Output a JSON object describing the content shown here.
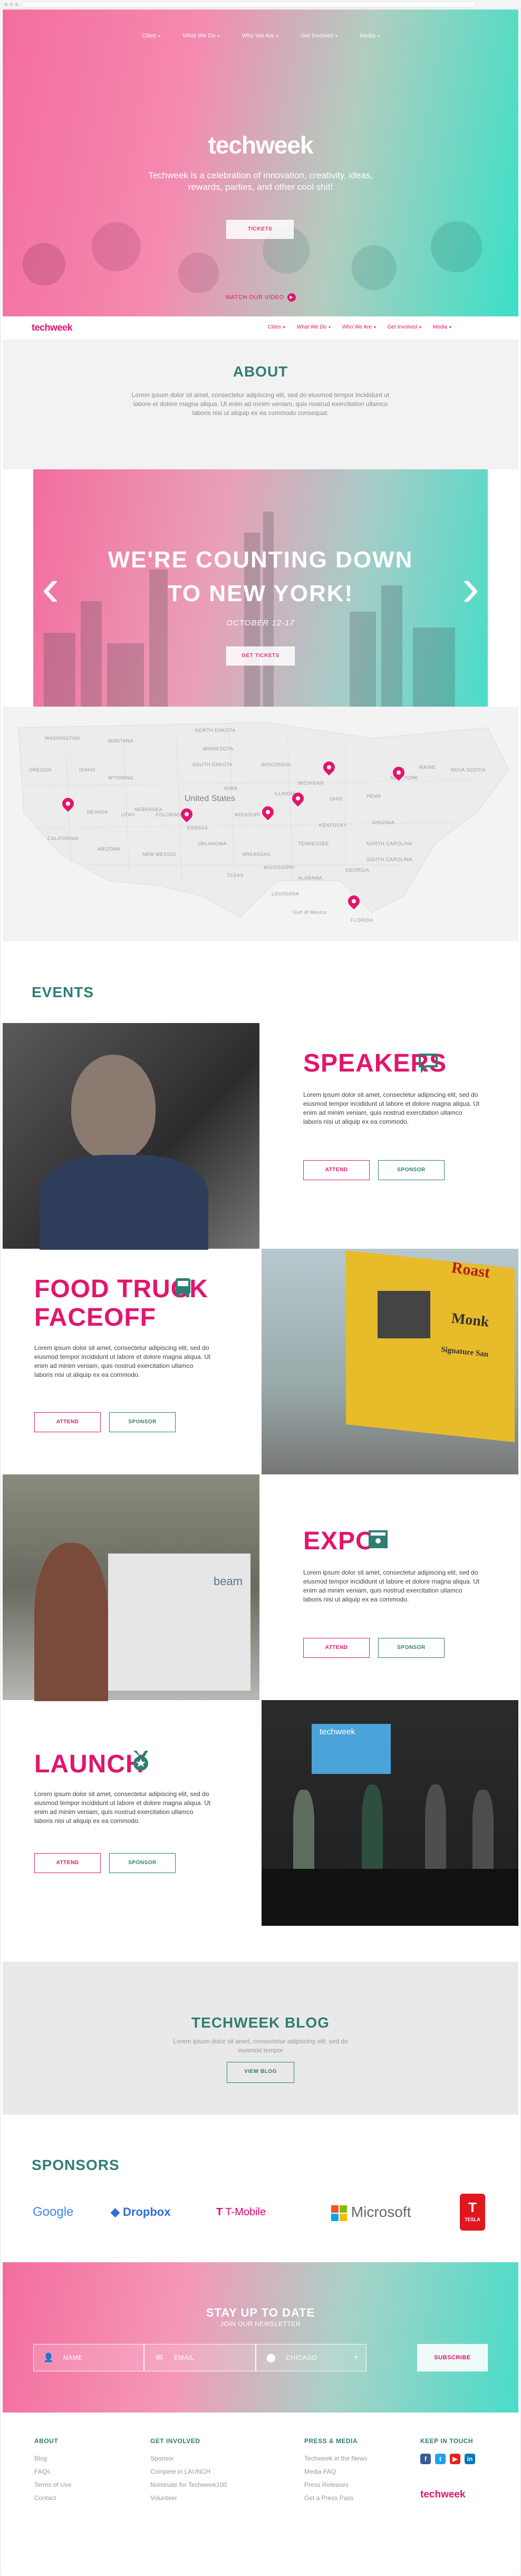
{
  "nav": {
    "cities": "Cities",
    "what_we_do": "What We Do",
    "who_we_are": "Who We Are",
    "get_involved": "Get Involved",
    "media": "Media"
  },
  "hero": {
    "logo": "techweek",
    "tagline": "Techweek is a celebration of innovation, creativity, ideas, rewards, parties, and other cool shit!",
    "tickets": "TICKETS",
    "watch": "WATCH OUR VIDEO"
  },
  "header": {
    "brand": "techweek"
  },
  "about": {
    "title": "ABOUT",
    "body": "Lorem ipsum dolor sit amet, consectetur adipiscing elit, sed do eiusmod tempor incididunt ut labore et dolore magna aliqua. Ut enim ad minim veniam, quis nostrud exercitation ullamco laboris nisi ut aliquip ex ea commodo consequat."
  },
  "promo": {
    "line1": "WE'RE COUNTING DOWN",
    "line2": "TO NEW YORK!",
    "date": "OCTOBER 12-17",
    "button": "GET TICKETS"
  },
  "map": {
    "center_label": "United States",
    "labels": [
      "WASHINGTON",
      "MONTANA",
      "NORTH DAKOTA",
      "MINNESOTA",
      "OREGON",
      "IDAHO",
      "SOUTH DAKOTA",
      "WISCONSIN",
      "WYOMING",
      "NEBRASKA",
      "IOWA",
      "MICHIGAN",
      "NEW YORK",
      "MAINE",
      "NOVA SCOTIA",
      "NEVADA",
      "UTAH",
      "COLORADO",
      "ILLINOIS",
      "OHIO",
      "PENN",
      "CALIFORNIA",
      "KANSAS",
      "MISSOURI",
      "KENTUCKY",
      "VIRGINIA",
      "ARIZONA",
      "NEW MEXICO",
      "OKLAHOMA",
      "TENNESSEE",
      "ARKANSAS",
      "NORTH CAROLINA",
      "SOUTH CAROLINA",
      "TEXAS",
      "MISSISSIPPI",
      "ALABAMA",
      "GEORGIA",
      "LOUISIANA",
      "FLORIDA",
      "Gulf of Mexico"
    ]
  },
  "events": {
    "title": "EVENTS",
    "attend": "ATTEND",
    "sponsor": "SPONSOR",
    "body": "Lorem ipsum dolor sit amet, consectetur adipiscing elit, sed do eiusmod tempor incididunt ut labore et dolore magna aliqua. Ut enim ad minim veniam, quis nostrud exercitation ullamco laboris nisi ut aliquip ex ea commodo.",
    "items": [
      {
        "title": "SPEAKERS",
        "icon": "speech-bubble-icon"
      },
      {
        "title": "FOOD TRUCK FACEOFF",
        "line1": "FOOD TRUCK",
        "line2": "FACEOFF",
        "icon": "truck-icon"
      },
      {
        "title": "EXPO",
        "icon": "booth-icon"
      },
      {
        "title": "LAUNCH",
        "icon": "star-ribbon-icon"
      }
    ],
    "truck_sign": "Roast",
    "truck_sign2": "Monk",
    "truck_sign3": "Signature San",
    "expo_booth": "beam",
    "launch_screen": "techweek"
  },
  "blog": {
    "title": "TECHWEEK BLOG",
    "body": "Lorem ipsum dolor sit amet, consectetur adipiscing elit, sed do eiusmod tempor",
    "button": "VIEW BLOG"
  },
  "sponsors": {
    "title": "SPONSORS",
    "names": [
      "Google",
      "Dropbox",
      "T-Mobile",
      "Microsoft",
      "TESLA"
    ],
    "tmobile_t": "T"
  },
  "newsletter": {
    "title": "STAY UP TO DATE",
    "subtitle": "JOIN OUR NEWSLETTER",
    "name_placeholder": "NAME",
    "email_placeholder": "EMAIL",
    "city_value": "CHICAGO",
    "subscribe": "SUBSCRIBE"
  },
  "footer": {
    "about": {
      "heading": "ABOUT",
      "links": [
        "Blog",
        "FAQs",
        "Terms of Use",
        "Contact"
      ]
    },
    "get_involved": {
      "heading": "GET INVOLVED",
      "links": [
        "Sponsor",
        "Compete in LAUNCH",
        "Nominate for Techweek100",
        "Volunteer"
      ]
    },
    "press": {
      "heading": "PRESS & MEDIA",
      "links": [
        "Techweek in the News",
        "Media FAQ",
        "Press Releases",
        "Get a Press Pass"
      ]
    },
    "touch": {
      "heading": "KEEP IN TOUCH",
      "brand": "techweek"
    }
  },
  "colors": {
    "pink": "#e2156d",
    "teal": "#2f7d73",
    "gradient_start": "#f36d9e",
    "gradient_end": "#39e0c7"
  }
}
